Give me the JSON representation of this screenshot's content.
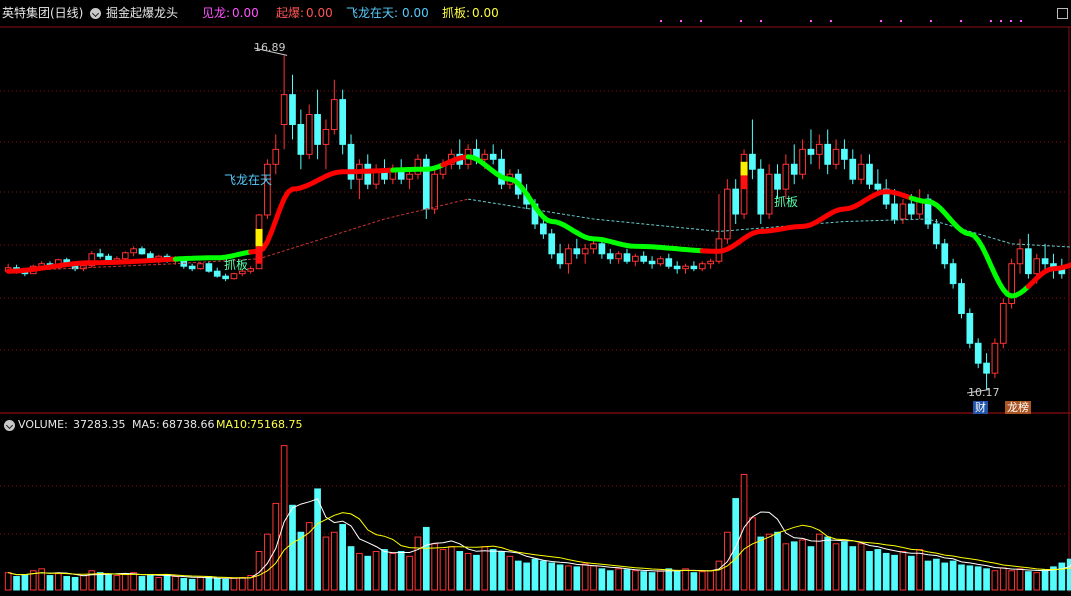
{
  "header": {
    "title": "英特集团(日线)",
    "indicator_name": "掘金起爆龙头",
    "fields": [
      {
        "label": "见龙:",
        "value": "0.00",
        "color": "#ff55ff"
      },
      {
        "label": "起爆:",
        "value": "0.00",
        "color": "#ff5555"
      },
      {
        "label": "飞龙在天:",
        "value": "0.00",
        "color": "#55ccff"
      },
      {
        "label": "抓板:",
        "value": "0.00",
        "color": "#ffff44"
      }
    ]
  },
  "volume_header": {
    "volume_label": "VOLUME:",
    "volume_value": "37283.35",
    "ma5_label": "MA5:",
    "ma5_value": "68738.66",
    "ma10_label": "MA10:",
    "ma10_value": "75168.75"
  },
  "annotations": {
    "high_label": "16.89",
    "low_label": "10.17",
    "feilong": "飞龙在天",
    "zhuaban1": "抓板",
    "zhuaban2": "抓板",
    "badge_cai": "财",
    "badge_bang": "龙榜"
  },
  "colors": {
    "up": "#ff3333",
    "down": "#54fcfc",
    "trend_up": "#ff0000",
    "trend_down": "#00ff00",
    "ma_dash_red": "#cc3333",
    "ma_dash_cyan": "#66cccc",
    "grid": "#8a1010",
    "ma5": "#ffffff",
    "ma10": "#ffff00"
  },
  "chart_data": {
    "type": "candlestick",
    "y_range": [
      10.0,
      17.4
    ],
    "high": 16.89,
    "low": 10.17,
    "candles": [
      [
        12.55,
        12.7,
        12.5,
        12.62
      ],
      [
        12.62,
        12.68,
        12.5,
        12.55
      ],
      [
        12.55,
        12.6,
        12.45,
        12.5
      ],
      [
        12.5,
        12.68,
        12.5,
        12.65
      ],
      [
        12.65,
        12.75,
        12.6,
        12.7
      ],
      [
        12.7,
        12.75,
        12.58,
        12.62
      ],
      [
        12.62,
        12.8,
        12.6,
        12.78
      ],
      [
        12.78,
        12.82,
        12.65,
        12.68
      ],
      [
        12.68,
        12.72,
        12.55,
        12.6
      ],
      [
        12.6,
        12.7,
        12.55,
        12.66
      ],
      [
        12.66,
        12.95,
        12.62,
        12.9
      ],
      [
        12.9,
        13.0,
        12.8,
        12.85
      ],
      [
        12.85,
        12.9,
        12.7,
        12.75
      ],
      [
        12.75,
        12.85,
        12.68,
        12.8
      ],
      [
        12.8,
        12.95,
        12.75,
        12.92
      ],
      [
        12.92,
        13.05,
        12.85,
        13.0
      ],
      [
        13.0,
        13.05,
        12.88,
        12.9
      ],
      [
        12.9,
        12.95,
        12.75,
        12.78
      ],
      [
        12.78,
        12.88,
        12.7,
        12.85
      ],
      [
        12.85,
        12.9,
        12.72,
        12.75
      ],
      [
        12.75,
        12.85,
        12.68,
        12.8
      ],
      [
        12.8,
        12.82,
        12.6,
        12.65
      ],
      [
        12.65,
        12.7,
        12.55,
        12.6
      ],
      [
        12.6,
        12.72,
        12.58,
        12.7
      ],
      [
        12.7,
        12.75,
        12.52,
        12.55
      ],
      [
        12.55,
        12.62,
        12.42,
        12.45
      ],
      [
        12.45,
        12.5,
        12.35,
        12.4
      ],
      [
        12.4,
        12.52,
        12.38,
        12.5
      ],
      [
        12.5,
        12.6,
        12.45,
        12.55
      ],
      [
        12.55,
        12.65,
        12.5,
        12.6
      ],
      [
        12.6,
        13.7,
        12.6,
        13.68
      ],
      [
        13.68,
        14.8,
        13.6,
        14.7
      ],
      [
        14.7,
        15.3,
        14.5,
        15.0
      ],
      [
        15.5,
        16.89,
        15.0,
        16.1
      ],
      [
        16.1,
        16.5,
        15.2,
        15.5
      ],
      [
        15.5,
        15.8,
        14.6,
        14.9
      ],
      [
        14.9,
        15.9,
        14.8,
        15.7
      ],
      [
        15.7,
        16.2,
        14.8,
        15.1
      ],
      [
        15.1,
        15.6,
        14.6,
        15.4
      ],
      [
        15.4,
        16.4,
        15.3,
        16.0
      ],
      [
        16.0,
        16.2,
        14.9,
        15.1
      ],
      [
        15.1,
        15.3,
        14.2,
        14.4
      ],
      [
        14.4,
        14.8,
        14.0,
        14.7
      ],
      [
        14.7,
        14.9,
        14.2,
        14.3
      ],
      [
        14.3,
        14.7,
        14.2,
        14.6
      ],
      [
        14.6,
        14.8,
        14.3,
        14.4
      ],
      [
        14.4,
        14.7,
        14.3,
        14.6
      ],
      [
        14.6,
        14.8,
        14.3,
        14.4
      ],
      [
        14.4,
        14.6,
        14.2,
        14.5
      ],
      [
        14.5,
        14.9,
        14.4,
        14.8
      ],
      [
        14.8,
        14.9,
        13.6,
        13.8
      ],
      [
        13.8,
        14.6,
        13.7,
        14.5
      ],
      [
        14.5,
        14.8,
        14.4,
        14.7
      ],
      [
        14.7,
        15.0,
        14.6,
        14.9
      ],
      [
        14.9,
        15.2,
        14.6,
        14.7
      ],
      [
        14.7,
        15.1,
        14.6,
        15.0
      ],
      [
        15.0,
        15.2,
        14.7,
        14.8
      ],
      [
        14.8,
        15.0,
        14.6,
        14.9
      ],
      [
        14.9,
        15.1,
        14.7,
        14.8
      ],
      [
        14.8,
        15.0,
        14.2,
        14.3
      ],
      [
        14.3,
        14.6,
        14.2,
        14.5
      ],
      [
        14.5,
        14.6,
        14.0,
        14.1
      ],
      [
        14.1,
        14.3,
        13.8,
        13.9
      ],
      [
        13.9,
        14.0,
        13.4,
        13.5
      ],
      [
        13.5,
        13.7,
        13.2,
        13.3
      ],
      [
        13.3,
        13.4,
        12.8,
        12.9
      ],
      [
        12.9,
        13.1,
        12.6,
        12.7
      ],
      [
        12.7,
        13.1,
        12.5,
        13.0
      ],
      [
        13.0,
        13.2,
        12.8,
        12.9
      ],
      [
        12.9,
        13.1,
        12.7,
        13.0
      ],
      [
        13.0,
        13.2,
        12.9,
        13.1
      ],
      [
        13.1,
        13.2,
        12.8,
        12.9
      ],
      [
        12.9,
        13.0,
        12.7,
        12.8
      ],
      [
        12.8,
        12.95,
        12.7,
        12.9
      ],
      [
        12.9,
        13.0,
        12.7,
        12.75
      ],
      [
        12.75,
        12.9,
        12.65,
        12.85
      ],
      [
        12.85,
        12.95,
        12.7,
        12.75
      ],
      [
        12.75,
        12.85,
        12.6,
        12.7
      ],
      [
        12.7,
        12.85,
        12.65,
        12.8
      ],
      [
        12.8,
        12.9,
        12.6,
        12.65
      ],
      [
        12.65,
        12.75,
        12.5,
        12.6
      ],
      [
        12.6,
        12.7,
        12.5,
        12.65
      ],
      [
        12.65,
        12.75,
        12.55,
        12.6
      ],
      [
        12.6,
        12.75,
        12.55,
        12.7
      ],
      [
        12.7,
        12.8,
        12.6,
        12.75
      ],
      [
        12.75,
        14.1,
        12.7,
        13.2
      ],
      [
        13.2,
        14.4,
        13.1,
        14.2
      ],
      [
        14.2,
        14.4,
        13.5,
        13.7
      ],
      [
        13.7,
        15.0,
        13.6,
        14.9
      ],
      [
        14.9,
        15.6,
        14.4,
        14.6
      ],
      [
        14.6,
        14.8,
        13.5,
        13.7
      ],
      [
        13.7,
        14.7,
        13.6,
        14.5
      ],
      [
        14.5,
        14.7,
        14.0,
        14.2
      ],
      [
        14.2,
        14.9,
        14.0,
        14.7
      ],
      [
        14.7,
        15.1,
        14.3,
        14.5
      ],
      [
        14.5,
        15.2,
        14.4,
        15.0
      ],
      [
        15.0,
        15.4,
        14.7,
        14.9
      ],
      [
        14.9,
        15.3,
        14.6,
        15.1
      ],
      [
        15.1,
        15.4,
        14.5,
        14.7
      ],
      [
        14.7,
        15.2,
        14.6,
        15.0
      ],
      [
        15.0,
        15.2,
        14.6,
        14.8
      ],
      [
        14.8,
        15.0,
        14.3,
        14.4
      ],
      [
        14.4,
        14.9,
        14.3,
        14.7
      ],
      [
        14.7,
        14.9,
        14.2,
        14.3
      ],
      [
        14.3,
        14.6,
        14.1,
        14.2
      ],
      [
        14.2,
        14.4,
        13.8,
        13.9
      ],
      [
        13.9,
        14.2,
        13.5,
        13.6
      ],
      [
        13.6,
        14.0,
        13.5,
        13.9
      ],
      [
        13.9,
        14.1,
        13.6,
        13.7
      ],
      [
        13.7,
        14.2,
        13.6,
        14.0
      ],
      [
        14.0,
        14.1,
        13.4,
        13.5
      ],
      [
        13.5,
        13.6,
        13.0,
        13.1
      ],
      [
        13.1,
        13.2,
        12.6,
        12.7
      ],
      [
        12.7,
        12.8,
        12.2,
        12.3
      ],
      [
        12.3,
        12.4,
        11.6,
        11.7
      ],
      [
        11.7,
        11.8,
        11.0,
        11.1
      ],
      [
        11.1,
        11.2,
        10.6,
        10.7
      ],
      [
        10.7,
        10.9,
        10.17,
        10.5
      ],
      [
        10.5,
        11.2,
        10.4,
        11.1
      ],
      [
        11.1,
        12.0,
        11.0,
        11.9
      ],
      [
        11.9,
        12.8,
        11.8,
        12.7
      ],
      [
        12.7,
        13.2,
        12.5,
        13.0
      ],
      [
        13.0,
        13.3,
        12.4,
        12.5
      ],
      [
        12.5,
        12.9,
        12.3,
        12.8
      ],
      [
        12.8,
        13.1,
        12.5,
        12.7
      ],
      [
        12.7,
        12.9,
        12.4,
        12.6
      ],
      [
        12.6,
        12.8,
        12.4,
        12.5
      ]
    ],
    "trend_line": [
      [
        0,
        12.55
      ],
      [
        10,
        12.72
      ],
      [
        25,
        12.82
      ],
      [
        30,
        12.95
      ],
      [
        34,
        14.2
      ],
      [
        40,
        14.55
      ],
      [
        50,
        14.6
      ],
      [
        55,
        14.85
      ],
      [
        60,
        14.4
      ],
      [
        65,
        13.55
      ],
      [
        70,
        13.2
      ],
      [
        75,
        13.05
      ],
      [
        85,
        12.95
      ],
      [
        90,
        13.35
      ],
      [
        95,
        13.45
      ],
      [
        100,
        13.8
      ],
      [
        105,
        14.15
      ],
      [
        110,
        13.95
      ],
      [
        115,
        13.3
      ],
      [
        120,
        12.05
      ],
      [
        125,
        12.6
      ],
      [
        130,
        12.8
      ],
      [
        131,
        12.72
      ]
    ],
    "trend_direction": [
      [
        "u",
        0,
        20
      ],
      [
        "d",
        20,
        29
      ],
      [
        "u",
        29,
        46
      ],
      [
        "d",
        46,
        52
      ],
      [
        "u",
        52,
        55
      ],
      [
        "d",
        55,
        83
      ],
      [
        "u",
        83,
        108
      ],
      [
        "d",
        108,
        122
      ],
      [
        "u",
        122,
        130
      ],
      [
        "d",
        130,
        131
      ]
    ],
    "ma_dashed": [
      [
        0,
        12.55
      ],
      [
        20,
        12.7
      ],
      [
        30,
        12.8
      ],
      [
        45,
        13.6
      ],
      [
        55,
        14.0
      ],
      [
        70,
        13.6
      ],
      [
        85,
        13.35
      ],
      [
        100,
        13.55
      ],
      [
        110,
        13.6
      ],
      [
        120,
        13.1
      ],
      [
        131,
        13.0
      ]
    ],
    "ma_dashed_cyan_from": 55,
    "volume": [
      18,
      14,
      16,
      20,
      22,
      15,
      17,
      14,
      13,
      15,
      20,
      18,
      16,
      15,
      17,
      18,
      14,
      15,
      13,
      16,
      14,
      12,
      11,
      13,
      14,
      12,
      11,
      12,
      13,
      15,
      40,
      58,
      90,
      150,
      88,
      60,
      70,
      105,
      55,
      60,
      68,
      45,
      38,
      35,
      40,
      42,
      38,
      40,
      35,
      55,
      65,
      48,
      42,
      45,
      40,
      38,
      36,
      45,
      42,
      40,
      35,
      30,
      28,
      32,
      30,
      28,
      26,
      25,
      24,
      27,
      25,
      22,
      20,
      22,
      21,
      20,
      19,
      18,
      20,
      22,
      20,
      22,
      18,
      19,
      20,
      30,
      60,
      95,
      120,
      75,
      55,
      58,
      60,
      48,
      50,
      52,
      45,
      58,
      55,
      48,
      50,
      45,
      48,
      40,
      42,
      38,
      36,
      40,
      35,
      42,
      30,
      32,
      28,
      30,
      26,
      25,
      24,
      22,
      20,
      23,
      20,
      22,
      19,
      18,
      21,
      24,
      28,
      32,
      95,
      52,
      38,
      28
    ],
    "volume_up": [
      1,
      0,
      0,
      1,
      1,
      0,
      1,
      0,
      0,
      1,
      1,
      0,
      0,
      1,
      1,
      1,
      0,
      0,
      1,
      0,
      1,
      0,
      0,
      1,
      0,
      0,
      0,
      1,
      1,
      1,
      1,
      1,
      1,
      1,
      0,
      0,
      1,
      0,
      1,
      1,
      0,
      0,
      1,
      0,
      1,
      0,
      1,
      0,
      1,
      1,
      0,
      1,
      1,
      1,
      0,
      1,
      0,
      1,
      0,
      0,
      1,
      0,
      0,
      0,
      0,
      0,
      0,
      1,
      0,
      1,
      1,
      0,
      0,
      1,
      0,
      1,
      0,
      0,
      1,
      0,
      0,
      1,
      0,
      1,
      1,
      1,
      1,
      0,
      1,
      1,
      0,
      1,
      0,
      1,
      0,
      1,
      0,
      1,
      0,
      1,
      0,
      0,
      1,
      0,
      0,
      0,
      0,
      1,
      0,
      1,
      0,
      0,
      0,
      0,
      0,
      0,
      0,
      0,
      1,
      1,
      1,
      1,
      0,
      1,
      0,
      0,
      0,
      0,
      1,
      0,
      0,
      0
    ],
    "volume_max": 160
  }
}
